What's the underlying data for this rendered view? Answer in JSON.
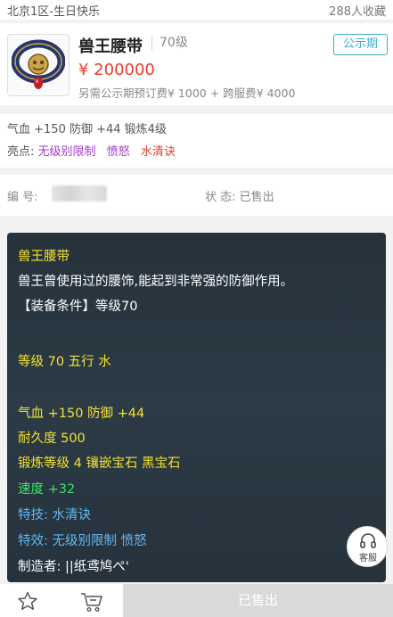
{
  "header": {
    "server": "北京1区-生日快乐",
    "favorites": "288人收藏"
  },
  "item": {
    "name": "兽王腰带",
    "level": "70级",
    "price": "¥ 200000",
    "extra_fee": "另需公示期预订费¥ 1000 + 跨服费¥ 4000",
    "badge": "公示期",
    "thumbnail_icon": "belt-icon"
  },
  "attributes": {
    "summary": "气血 +150 防御 +44 锻炼4级",
    "highlight_label": "亮点:",
    "highlights": [
      {
        "text": "无级别限制",
        "color": "#a53bd1"
      },
      {
        "text": "愤怒",
        "color": "#a53bd1"
      },
      {
        "text": "水清诀",
        "color": "#e2402c"
      }
    ]
  },
  "info": {
    "id_label": "编 号:",
    "status": "状 态: 已售出"
  },
  "description": [
    {
      "text": "兽王腰带",
      "color": "yellow"
    },
    {
      "text": "兽王曾使用过的腰饰,能起到非常强的防御作用。",
      "color": "white"
    },
    {
      "text": "【装备条件】等级70",
      "color": "white"
    },
    {
      "text": "",
      "color": "white"
    },
    {
      "text": "等级 70 五行 水",
      "color": "yellow"
    },
    {
      "text": "",
      "color": "white"
    },
    {
      "text": "气血 +150 防御 +44",
      "color": "yellow"
    },
    {
      "text": "耐久度 500",
      "color": "yellow"
    },
    {
      "text": "锻炼等级 4 镶嵌宝石 黑宝石",
      "color": "yellow"
    },
    {
      "text": "速度 +32",
      "color": "green"
    },
    {
      "text": "特技: 水清诀",
      "color": "blue"
    },
    {
      "text": "特效: 无级别限制 愤怒",
      "color": "blue"
    },
    {
      "text": "制造者: ||纸鸢鸠ぺ'",
      "color": "white"
    }
  ],
  "service": {
    "label": "客服",
    "icon": "headset-icon"
  },
  "bottom_bar": {
    "favorite_icon": "star-icon",
    "cart_icon": "cart-icon",
    "sold_label": "已售出"
  }
}
